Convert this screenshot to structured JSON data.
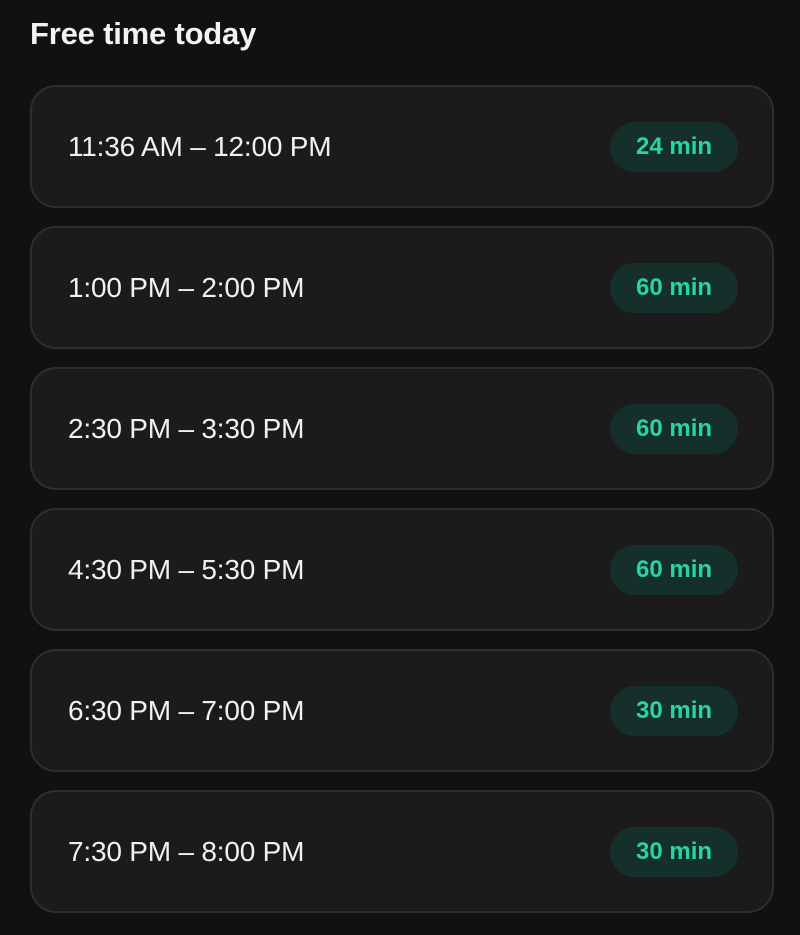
{
  "section": {
    "title": "Free time today"
  },
  "slots": [
    {
      "time": "11:36 AM – 12:00 PM",
      "duration": "24 min"
    },
    {
      "time": "1:00 PM – 2:00 PM",
      "duration": "60 min"
    },
    {
      "time": "2:30 PM – 3:30 PM",
      "duration": "60 min"
    },
    {
      "time": "4:30 PM – 5:30 PM",
      "duration": "60 min"
    },
    {
      "time": "6:30 PM – 7:00 PM",
      "duration": "30 min"
    },
    {
      "time": "7:30 PM – 8:00 PM",
      "duration": "30 min"
    }
  ],
  "colors": {
    "background": "#111111",
    "card": "#1b1b1b",
    "card_border": "#2e2e2e",
    "badge_bg": "#15302a",
    "accent": "#2ad3a6",
    "text": "#f1f1f1"
  }
}
